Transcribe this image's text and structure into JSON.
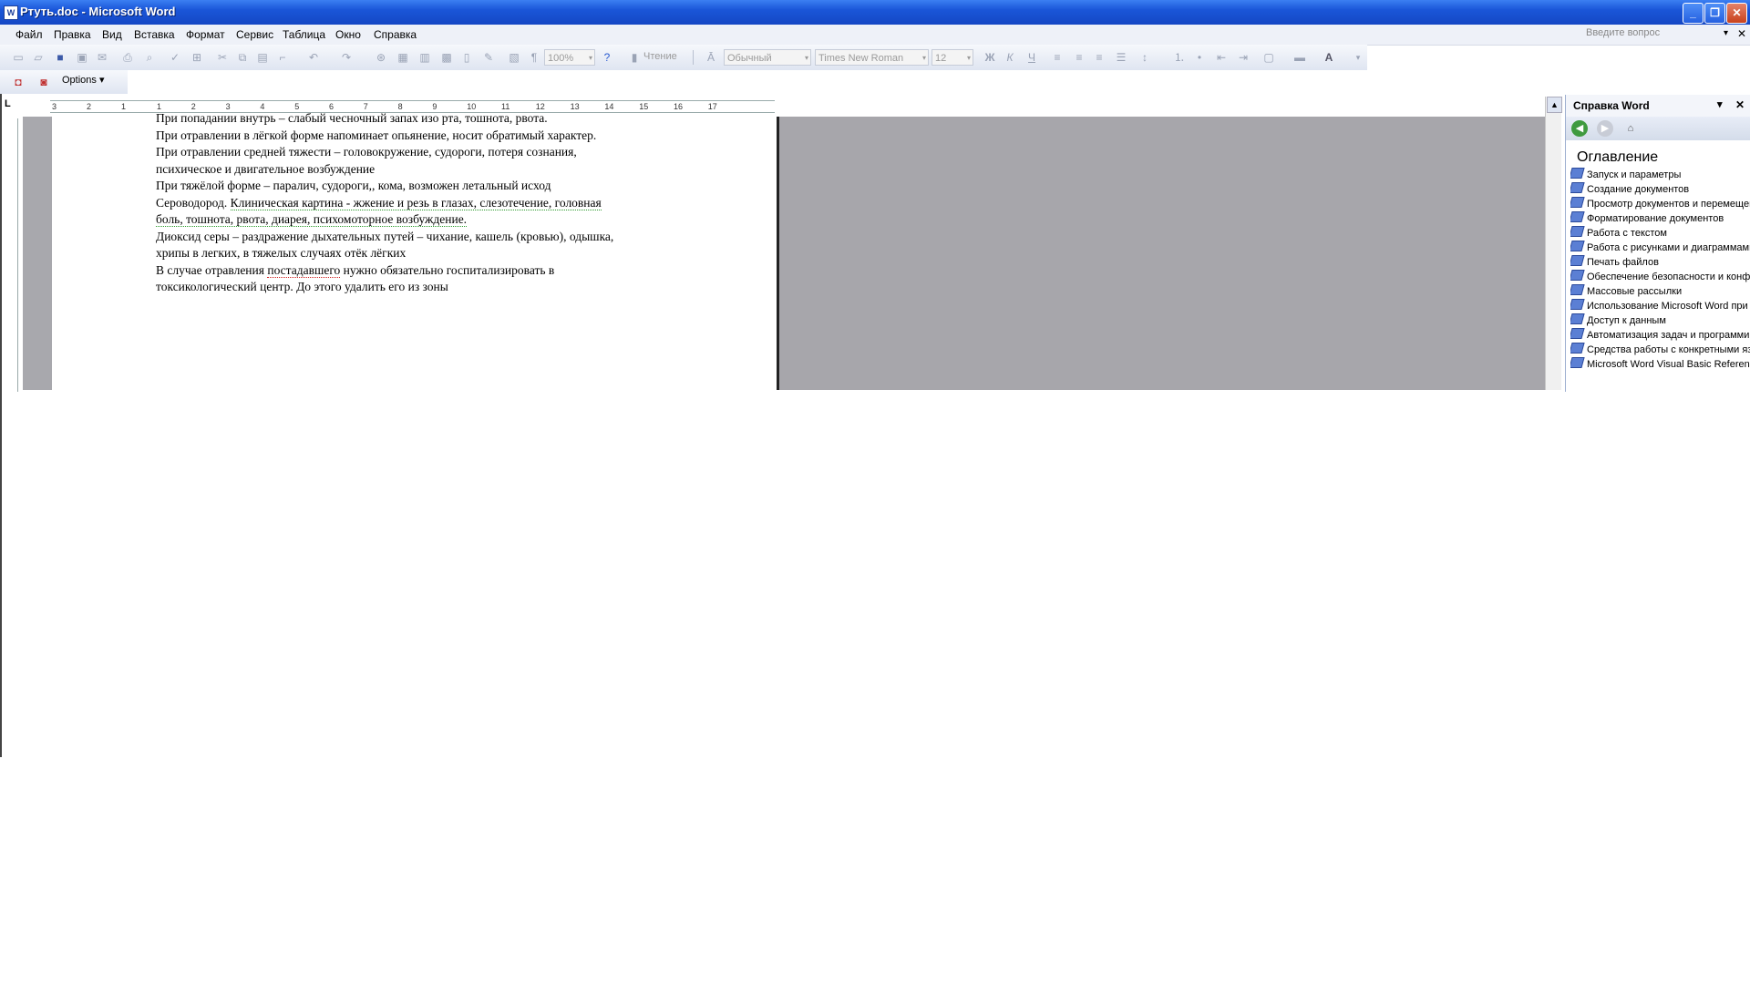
{
  "window": {
    "title": "Ртуть.doc - Microsoft Word",
    "doc_icon_letter": "W",
    "controls": {
      "minimize": "_",
      "maximize": "❐",
      "close": "✕"
    }
  },
  "menu": {
    "items": [
      "Файл",
      "Правка",
      "Вид",
      "Вставка",
      "Формат",
      "Сервис",
      "Таблица",
      "Окно",
      "Справка"
    ],
    "ask_placeholder": "Введите вопрос",
    "close": "✕",
    "dropdown": "▾"
  },
  "toolbar": {
    "zoom": "100%",
    "reading": "Чтение",
    "style": "Обычный",
    "font": "Times New Roman",
    "size": "12",
    "bold": "Ж",
    "italic": "К",
    "underline": "Ч",
    "font_color": "A"
  },
  "toolbar2": {
    "options_label": "Options ▾"
  },
  "ruler": {
    "corner": "L",
    "labels": [
      "3",
      "2",
      "1",
      "1",
      "2",
      "3",
      "4",
      "5",
      "6",
      "7",
      "8",
      "9",
      "10",
      "11",
      "12",
      "13",
      "14",
      "15",
      "16",
      "17"
    ]
  },
  "document": {
    "lines": [
      "При попадании внутрь – слабый чесночный запах изо рта, тошнота, рвота.",
      "При отравлении в лёгкой форме напоминает опьянение, носит обратимый характер.",
      "При отравлении средней тяжести – головокружение, судороги, потеря сознания,",
      "психическое и двигательное возбуждение",
      "При тяжёлой форме – паралич, судороги,, кома, возможен летальный исход"
    ],
    "h2s_prefix": "Сероводород. ",
    "h2s_rest": "Клиническая картина  - жжение и резь в глазах, слезотечение, головная",
    "h2s_line2": "боль, тошнота, рвота, диарея, психомоторное возбуждение.",
    "so2_line1": "Диоксид серы – раздражение дыхательных путей – чихание, кашель (кровью), одышка,",
    "so2_line2": "хрипы в легких, в тяжелых случаях отёк лёгких",
    "final_a": "В случае отравления ",
    "final_err": "постадавшего",
    "final_b": " нужно обязательно госпитализировать в",
    "final_line2": "токсикологический центр. До этого удалить его из зоны"
  },
  "task_pane": {
    "title": "Справка Word",
    "dropdown": "▾",
    "close": "✕",
    "toc_title": "Оглавление",
    "items": [
      "Запуск и параметры",
      "Создание документов",
      "Просмотр документов и перемещение",
      "Форматирование документов",
      "Работа с текстом",
      "Работа с рисунками и диаграммами",
      "Печать файлов",
      "Обеспечение безопасности и конфиденциальности",
      "Массовые рассылки",
      "Использование Microsoft Word при",
      "Доступ к данным",
      "Автоматизация задач и программирование",
      "Средства работы с конкретными языками",
      "Microsoft Word Visual Basic Reference"
    ]
  }
}
